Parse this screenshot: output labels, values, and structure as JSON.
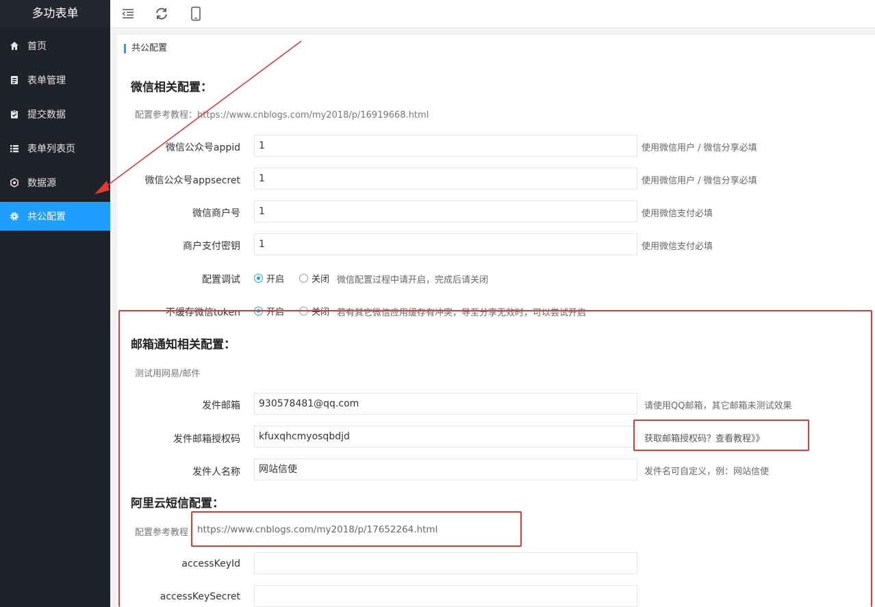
{
  "sidebar": {
    "logo": "多功表单",
    "items": [
      {
        "label": "首页",
        "icon": "home-icon"
      },
      {
        "label": "表单管理",
        "icon": "form-icon"
      },
      {
        "label": "提交数据",
        "icon": "clipboard-icon"
      },
      {
        "label": "表单列表页",
        "icon": "list-icon"
      },
      {
        "label": "数据源",
        "icon": "datasource-icon"
      },
      {
        "label": "共公配置",
        "icon": "gear-icon"
      }
    ],
    "active": "共公配置"
  },
  "topbar": {
    "icons": [
      "menu-collapse-icon",
      "refresh-icon",
      "mobile-icon"
    ]
  },
  "breadcrumb": "共公配置",
  "wechat": {
    "title": "微信相关配置：",
    "hint": "配置参考教程：https://www.cnblogs.com/my2018/p/16919668.html",
    "fields": [
      {
        "label": "微信公众号appid",
        "value": "1",
        "tip": "使用微信用户 / 微信分享必填"
      },
      {
        "label": "微信公众号appsecret",
        "value": "1",
        "tip": "使用微信用户 / 微信分享必填"
      },
      {
        "label": "微信商户号",
        "value": "1",
        "tip": "使用微信支付必填"
      },
      {
        "label": "商户支付密钥",
        "value": "1",
        "tip": "使用微信支付必填"
      }
    ],
    "debug": {
      "label": "配置调试",
      "on": "开启",
      "off": "关闭",
      "tip": "微信配置过程中请开启，完成后请关闭"
    },
    "nocache": {
      "label": "不缓存微信token",
      "on": "开启",
      "off": "关闭",
      "tip": "若有其它微信应用缓存有冲突，导至分享无效时，可以尝试开启"
    }
  },
  "email": {
    "title": "邮箱通知相关配置：",
    "hint": "测试用网易/邮件",
    "fields": [
      {
        "label": "发件邮箱",
        "value": "930578481@qq.com",
        "tip": "请使用QQ邮箱，其它邮箱未测试效果"
      },
      {
        "label": "发件邮箱授权码",
        "value": "kfuxqhcmyosqbdjd",
        "tip": "获取邮箱授权码？查看教程》》"
      },
      {
        "label": "发件人名称",
        "value": "网站信使",
        "tip": "发件名可自定义，例：网站信使"
      }
    ]
  },
  "aliyun": {
    "title": "阿里云短信配置：",
    "hint_label": "配置参考教程",
    "hint_link": "https://www.cnblogs.com/my2018/p/17652264.html",
    "fields": [
      {
        "label": "accessKeyId",
        "value": ""
      },
      {
        "label": "accessKeySecret",
        "value": ""
      }
    ]
  },
  "colors": {
    "sidebar": "#20222a",
    "accent": "#1e9fff",
    "annotation": "#e53935"
  }
}
